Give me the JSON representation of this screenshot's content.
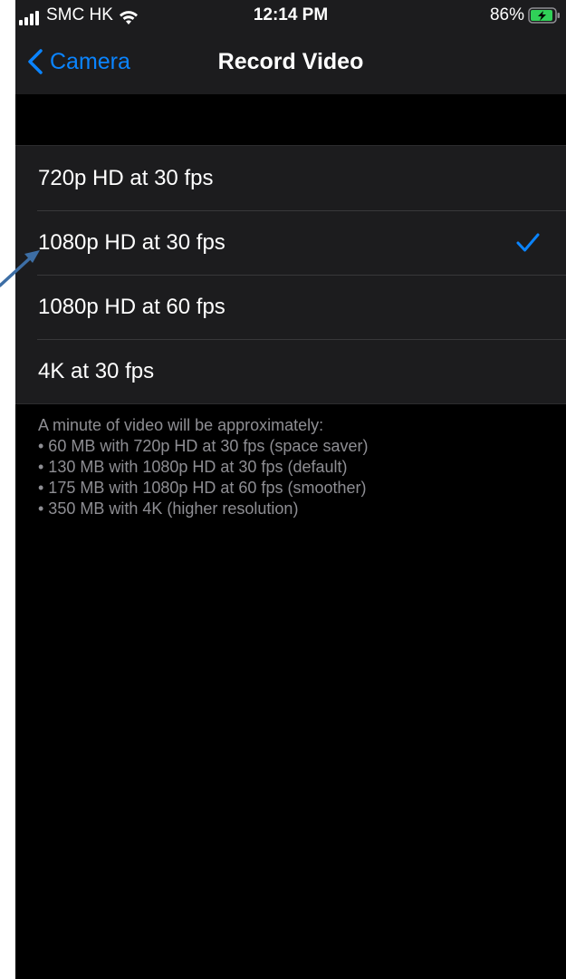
{
  "status_bar": {
    "carrier": "SMC HK",
    "time": "12:14 PM",
    "battery_percent": "86%",
    "signal_icon": "cellular-signal-icon",
    "wifi_icon": "wifi-icon",
    "battery_icon": "battery-charging-icon"
  },
  "nav": {
    "back_label": "Camera",
    "title": "Record Video"
  },
  "options": [
    {
      "label": "720p HD at 30 fps",
      "selected": false
    },
    {
      "label": "1080p HD at 30 fps",
      "selected": true
    },
    {
      "label": "1080p HD at 60 fps",
      "selected": false
    },
    {
      "label": "4K at 30 fps",
      "selected": false
    }
  ],
  "note": {
    "lines": [
      "A minute of video will be approximately:",
      "• 60 MB with 720p HD at 30 fps (space saver)",
      "• 130 MB with 1080p HD at 30 fps (default)",
      "• 175 MB with 1080p HD at 60 fps (smoother)",
      "• 350 MB with 4K (higher resolution)"
    ]
  },
  "colors": {
    "accent": "#0a84ff",
    "background": "#000000",
    "group_background": "#1c1c1e",
    "secondary_text": "#8e8e93",
    "annotation_arrow": "#3d6ea5"
  }
}
